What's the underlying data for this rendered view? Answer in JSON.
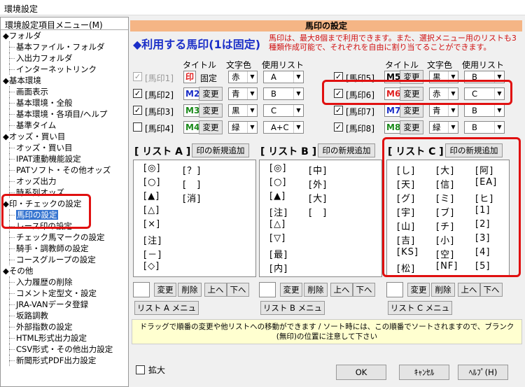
{
  "window_title": "環境設定",
  "menu_header": "環境設定項目メニュー(M)",
  "tree": [
    {
      "t": "cat",
      "label": "◆フォルダ"
    },
    {
      "t": "item",
      "label": "基本ファイル・フォルダ"
    },
    {
      "t": "item",
      "label": "入出力フォルダ"
    },
    {
      "t": "item",
      "label": "インターネットリンク"
    },
    {
      "t": "cat",
      "label": "◆基本環境"
    },
    {
      "t": "item",
      "label": "画面表示"
    },
    {
      "t": "item",
      "label": "基本環境・全般"
    },
    {
      "t": "item",
      "label": "基本環境・各項目/ヘルプ"
    },
    {
      "t": "item",
      "label": "基準タイム"
    },
    {
      "t": "cat",
      "label": "◆オッズ・買い目"
    },
    {
      "t": "item",
      "label": "オッズ・買い目"
    },
    {
      "t": "item",
      "label": "IPAT連動機能設定"
    },
    {
      "t": "item",
      "label": "PATソフト・その他オッズ"
    },
    {
      "t": "item",
      "label": "オッズ出力"
    },
    {
      "t": "item",
      "label": "時系列オッズ"
    },
    {
      "t": "cat",
      "label": "◆印・チェックの設定"
    },
    {
      "t": "item",
      "label": "馬印の設定",
      "sel": true
    },
    {
      "t": "item",
      "label": "レース印の設定"
    },
    {
      "t": "item",
      "label": "チェック馬マークの設定"
    },
    {
      "t": "item",
      "label": "騎手・調教師の設定"
    },
    {
      "t": "item",
      "label": "コースグループの設定"
    },
    {
      "t": "cat",
      "label": "◆その他"
    },
    {
      "t": "item",
      "label": "入力履歴の削除"
    },
    {
      "t": "item",
      "label": "コメント定型文・設定"
    },
    {
      "t": "item",
      "label": "JRA-VANデータ登録"
    },
    {
      "t": "item",
      "label": "坂路調教"
    },
    {
      "t": "item",
      "label": "外部指数の設定"
    },
    {
      "t": "item",
      "label": "HTML形式出力設定"
    },
    {
      "t": "item",
      "label": "CSV形式・その他出力設定"
    },
    {
      "t": "item",
      "label": "新聞形式PDF出力設定"
    }
  ],
  "panel_title": "馬印の設定",
  "heading": "◆利用する馬印(1は固定)",
  "note": "馬印は、最大8個まで利用できます。また、選択メニュー用のリストも3種類作成可能で、それぞれを自由に割り当てることができます。",
  "col_headers": {
    "title": "タイトル",
    "color": "文字色",
    "list": "使用リスト"
  },
  "marks_left": [
    {
      "label": "[馬印1]",
      "checked": true,
      "disabled": true,
      "mark": "印",
      "mark_color": "#e02020",
      "fixed": "固定",
      "color": "赤",
      "list": "A"
    },
    {
      "label": "[馬印2]",
      "checked": true,
      "mark": "M2",
      "mark_color": "#1a2ec8",
      "btn": "変更",
      "color": "青",
      "list": "B"
    },
    {
      "label": "[馬印3]",
      "checked": true,
      "mark": "M3",
      "mark_color": "#1a8a1a",
      "btn": "変更",
      "color": "黒",
      "list": "C"
    },
    {
      "label": "[馬印4]",
      "checked": false,
      "mark": "M4",
      "mark_color": "#1a8a1a",
      "btn": "変更",
      "color": "緑",
      "list": "A+C"
    }
  ],
  "marks_right": [
    {
      "label": "[馬印5]",
      "checked": true,
      "mark": "M5",
      "mark_color": "#000000",
      "btn": "変更",
      "color": "黒",
      "list": "B"
    },
    {
      "label": "[馬印6]",
      "checked": true,
      "mark": "M6",
      "mark_color": "#e02020",
      "btn": "変更",
      "color": "赤",
      "list": "C"
    },
    {
      "label": "[馬印7]",
      "checked": true,
      "mark": "M7",
      "mark_color": "#1a2ec8",
      "btn": "変更",
      "color": "青",
      "list": "B"
    },
    {
      "label": "[馬印8]",
      "checked": true,
      "mark": "M8",
      "mark_color": "#1a8a1a",
      "btn": "変更",
      "color": "緑",
      "list": "B"
    }
  ],
  "lists": [
    {
      "title": "[ リスト A ]",
      "add": "印の新規追加",
      "cols": [
        [
          "[◎]",
          "[○]",
          "[▲]",
          "[△]",
          "[×]",
          "[注]",
          "[－]",
          "[◇]"
        ],
        [
          "[？]",
          "[　]",
          "[消]"
        ]
      ],
      "menu": "リスト A メニュー"
    },
    {
      "title": "[ リスト B ]",
      "add": "印の新規追加",
      "cols": [
        [
          "[◎]",
          "[○]",
          "[▲]",
          "[注]",
          "[△]",
          "[▽]",
          "[最]",
          "[内]"
        ],
        [
          "[中]",
          "[外]",
          "[大]",
          "[　]"
        ]
      ],
      "menu": "リスト B メニュー"
    },
    {
      "title": "[ リスト C ]",
      "add": "印の新規追加",
      "cols": [
        [
          "[し]",
          "[天]",
          "[グ]",
          "[宇]",
          "[山]",
          "[吉]",
          "[KS]",
          "[松]"
        ],
        [
          "[大]",
          "[信]",
          "[ミ]",
          "[ブ]",
          "[チ]",
          "[小]",
          "[空]",
          "[NF]"
        ],
        [
          "[阿]",
          "[EA]",
          "[ヒ]",
          "[1]",
          "[2]",
          "[3]",
          "[4]",
          "[5]"
        ]
      ],
      "menu": "リスト C メニュー"
    }
  ],
  "list_buttons": {
    "change": "変更",
    "delete": "削除",
    "up": "上へ",
    "down": "下へ"
  },
  "hint": "ドラッグで順番の変更や他リストへの移動ができます / ソート時には、この順番でソートされますので、ブランク(無印)の位置に注意して下さい",
  "zoom_label": "拡大",
  "ok": "OK",
  "cancel": "ｷｬﾝｾﾙ",
  "help": "ﾍﾙﾌﾟ(H)"
}
